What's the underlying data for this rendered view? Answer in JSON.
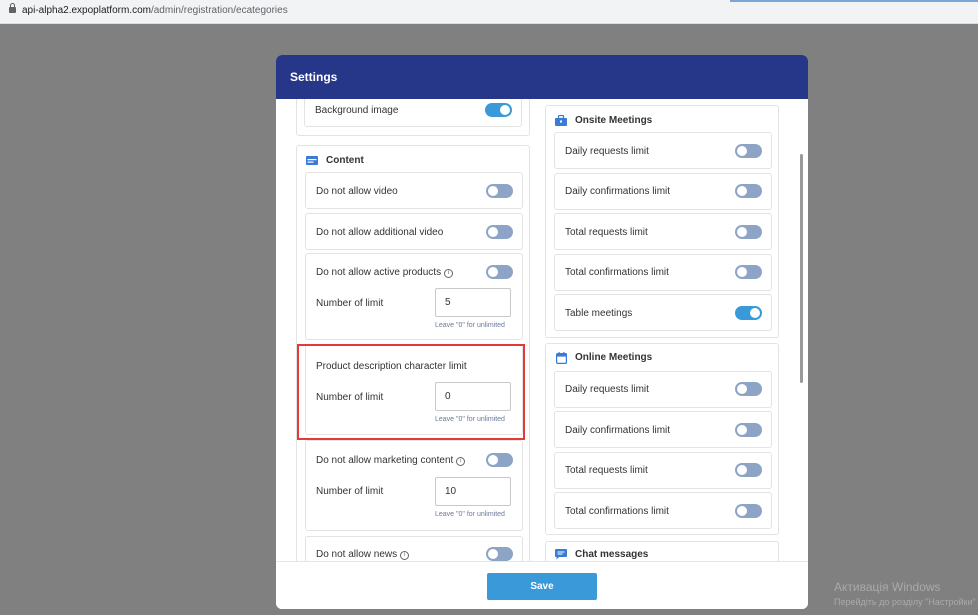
{
  "browser": {
    "url_domain": "api-alpha2.expoplatform.com",
    "url_path": "/admin/registration/ecategories"
  },
  "modal": {
    "title": "Settings",
    "save_label": "Save"
  },
  "left": {
    "background_image": {
      "label": "Background image",
      "enabled": true
    },
    "content_title": "Content",
    "do_not_allow_video": {
      "label": "Do not allow video",
      "enabled": false
    },
    "do_not_allow_additional_video": {
      "label": "Do not allow additional video",
      "enabled": false
    },
    "do_not_allow_active_products": {
      "label": "Do not allow active products",
      "enabled": false,
      "limit_label": "Number of limit",
      "limit_value": "5",
      "hint": "Leave \"0\" for unlimited"
    },
    "product_description": {
      "label": "Product description character limit",
      "limit_label": "Number of limit",
      "limit_value": "0",
      "hint": "Leave \"0\" for unlimited"
    },
    "do_not_allow_marketing": {
      "label": "Do not allow marketing content",
      "enabled": false,
      "limit_label": "Number of limit",
      "limit_value": "10",
      "hint": "Leave \"0\" for unlimited"
    },
    "do_not_allow_news": {
      "label": "Do not allow news",
      "enabled": false
    }
  },
  "right": {
    "onsite_title": "Onsite Meetings",
    "onsite": [
      {
        "label": "Daily requests limit",
        "enabled": false
      },
      {
        "label": "Daily confirmations limit",
        "enabled": false
      },
      {
        "label": "Total requests limit",
        "enabled": false
      },
      {
        "label": "Total confirmations limit",
        "enabled": false
      },
      {
        "label": "Table meetings",
        "enabled": true
      }
    ],
    "online_title": "Online Meetings",
    "online": [
      {
        "label": "Daily requests limit",
        "enabled": false
      },
      {
        "label": "Daily confirmations limit",
        "enabled": false
      },
      {
        "label": "Total requests limit",
        "enabled": false
      },
      {
        "label": "Total confirmations limit",
        "enabled": false
      }
    ],
    "chat_title": "Chat messages"
  },
  "os_watermark": {
    "line1": "Активація Windows",
    "line2": "Перейдіть до розділу \"Настройки\""
  },
  "colors": {
    "header": "#263688",
    "accent": "#3a9ad9",
    "toggle_off": "#8ea4c6",
    "highlight": "#e53935"
  }
}
